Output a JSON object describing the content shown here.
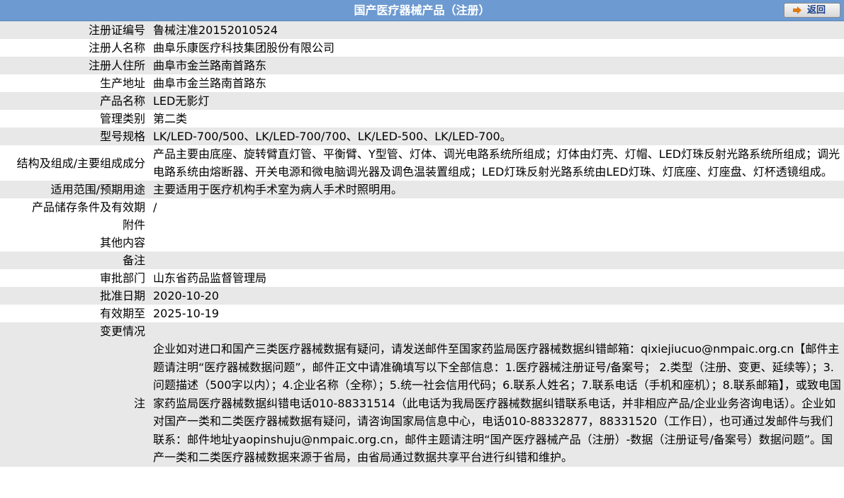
{
  "header": {
    "title": "国产医疗器械产品（注册）",
    "back_label": "返回"
  },
  "rows": [
    {
      "label": "注册证编号",
      "value": "鲁械注准20152010524"
    },
    {
      "label": "注册人名称",
      "value": "曲阜乐康医疗科技集团股份有限公司"
    },
    {
      "label": "注册人住所",
      "value": "曲阜市金兰路南首路东"
    },
    {
      "label": "生产地址",
      "value": "曲阜市金兰路南首路东"
    },
    {
      "label": "产品名称",
      "value": "LED无影灯"
    },
    {
      "label": "管理类别",
      "value": "第二类"
    },
    {
      "label": "型号规格",
      "value": "LK/LED-700/500、LK/LED-700/700、LK/LED-500、LK/LED-700。"
    },
    {
      "label": "结构及组成/主要组成成分",
      "value": "产品主要由底座、旋转臂直灯管、平衡臂、Y型管、灯体、调光电路系统所组成；灯体由灯壳、灯帽、LED灯珠反射光路系统所组成；调光电路系统由熔断器、开关电源和微电脑调光器及调色温装置组成；LED灯珠反射光路系统由LED灯珠、灯底座、灯座盘、灯杯透镜组成。"
    },
    {
      "label": "适用范围/预期用途",
      "value": "主要适用于医疗机构手术室为病人手术时照明用。"
    },
    {
      "label": "产品储存条件及有效期",
      "value": "/"
    },
    {
      "label": "附件",
      "value": ""
    },
    {
      "label": "其他内容",
      "value": ""
    },
    {
      "label": "备注",
      "value": ""
    },
    {
      "label": "审批部门",
      "value": "山东省药品监督管理局"
    },
    {
      "label": "批准日期",
      "value": "2020-10-20"
    },
    {
      "label": "有效期至",
      "value": "2025-10-19"
    },
    {
      "label": "变更情况",
      "value": ""
    }
  ],
  "note": {
    "label": "注",
    "text": "企业如对进口和国产三类医疗器械数据有疑问，请发送邮件至国家药监局医疗器械数据纠错邮箱：qixiejiucuo@nmpaic.org.cn【邮件主题请注明“医疗器械数据问题”，邮件正文中请准确填写以下全部信息：1.医疗器械注册证号/备案号； 2.类型（注册、变更、延续等）；3.问题描述（500字以内）；4.企业名称（全称）；5.统一社会信用代码；6.联系人姓名；7.联系电话（手机和座机）；8.联系邮箱】，或致电国家药监局医疗器械数据纠错电话010-88331514（此电话为我局医疗器械数据纠错联系电话，并非相应产品/企业业务咨询电话）。企业如对国产一类和二类医疗器械数据有疑问，请咨询国家局信息中心，电话010-88332877，88331520（工作日），也可通过发邮件与我们联系：邮件地址yaopinshuju@nmpaic.org.cn，邮件主题请注明“国产医疗器械产品（注册）-数据（注册证号/备案号）数据问题”。国产一类和二类医疗器械数据来源于省局，由省局通过数据共享平台进行纠错和维护。"
  }
}
